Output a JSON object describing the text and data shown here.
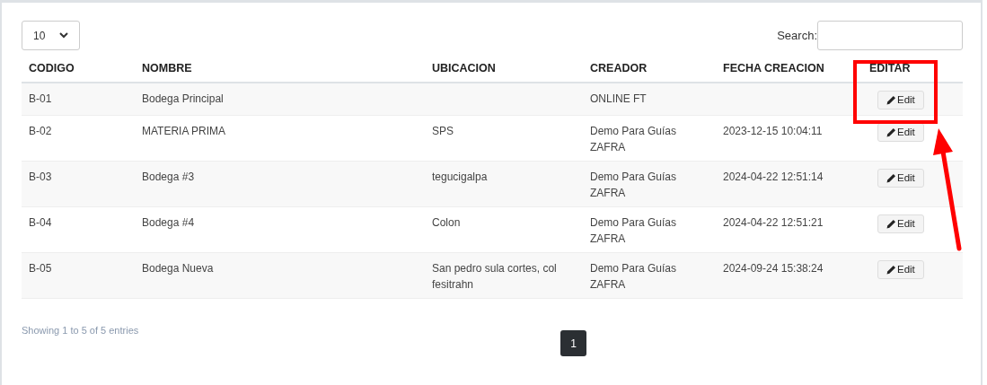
{
  "page_length": {
    "value": "10"
  },
  "search": {
    "label": "Search:"
  },
  "table": {
    "columns": [
      "CODIGO",
      "NOMBRE",
      "UBICACION",
      "CREADOR",
      "FECHA CREACION",
      "EDITAR"
    ],
    "rows": [
      {
        "codigo": "B-01",
        "nombre": "Bodega Principal",
        "ubicacion": "",
        "creador": "ONLINE FT",
        "fecha": "",
        "action": "Edit"
      },
      {
        "codigo": "B-02",
        "nombre": "MATERIA PRIMA",
        "ubicacion": "SPS",
        "creador": "Demo Para Guías ZAFRA",
        "fecha": "2023-12-15 10:04:11",
        "action": "Edit"
      },
      {
        "codigo": "B-03",
        "nombre": "Bodega #3",
        "ubicacion": "tegucigalpa",
        "creador": "Demo Para Guías ZAFRA",
        "fecha": "2024-04-22 12:51:14",
        "action": "Edit"
      },
      {
        "codigo": "B-04",
        "nombre": "Bodega #4",
        "ubicacion": "Colon",
        "creador": "Demo Para Guías ZAFRA",
        "fecha": "2024-04-22 12:51:21",
        "action": "Edit"
      },
      {
        "codigo": "B-05",
        "nombre": "Bodega Nueva",
        "ubicacion": "San pedro sula cortes, col fesitrahn",
        "creador": "Demo Para Guías ZAFRA",
        "fecha": "2024-09-24 15:38:24",
        "action": "Edit"
      }
    ]
  },
  "info": "Showing 1 to 5 of 5 entries",
  "pagination": [
    {
      "label": "1",
      "selected": true
    }
  ]
}
